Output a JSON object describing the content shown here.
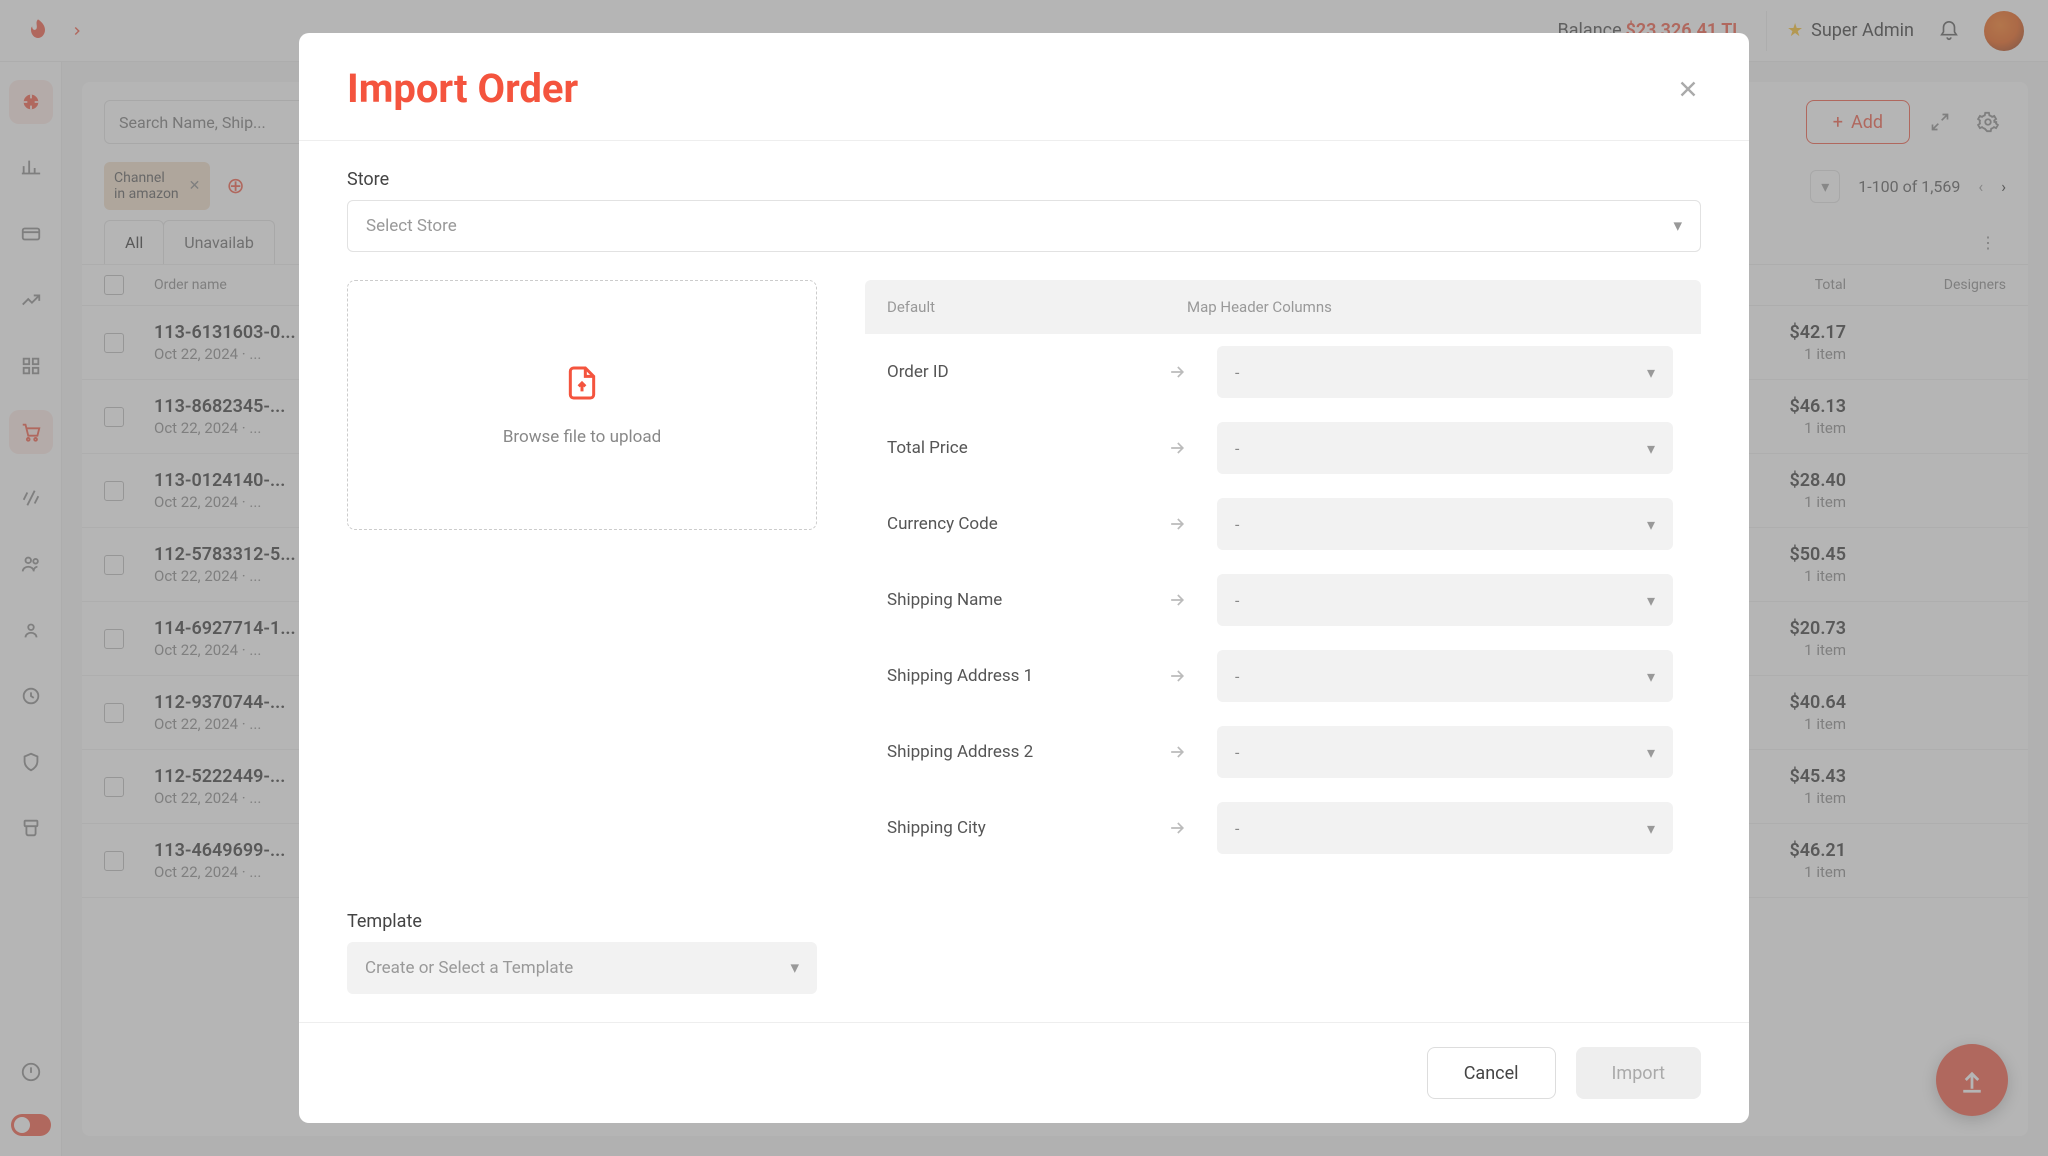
{
  "topbar": {
    "balance_label": "Balance",
    "balance_amount": "$23,326.41 TL",
    "role": "Super Admin"
  },
  "search": {
    "placeholder": "Search Name, Ship..."
  },
  "toolbar": {
    "add_label": "Add"
  },
  "filter_chip": {
    "label_line1": "Channel",
    "label_line2": "in amazon"
  },
  "pager": {
    "range": "1-100 of 1,569"
  },
  "tabs": {
    "all": "All",
    "unavailable": "Unavailab"
  },
  "columns": {
    "order_name": "Order name",
    "total": "Total",
    "designers": "Designers"
  },
  "orders": [
    {
      "id": "113-6131603-0...",
      "date": "Oct 22, 2024 · ...",
      "total": "$42.17",
      "items": "1 item"
    },
    {
      "id": "113-8682345-...",
      "date": "Oct 22, 2024 · ...",
      "total": "$46.13",
      "items": "1 item"
    },
    {
      "id": "113-0124140-...",
      "date": "Oct 22, 2024 · ...",
      "total": "$28.40",
      "items": "1 item"
    },
    {
      "id": "112-5783312-5...",
      "date": "Oct 22, 2024 · ...",
      "total": "$50.45",
      "items": "1 item"
    },
    {
      "id": "114-6927714-1...",
      "date": "Oct 22, 2024 · ...",
      "total": "$20.73",
      "items": "1 item"
    },
    {
      "id": "112-9370744-...",
      "date": "Oct 22, 2024 · ...",
      "total": "$40.64",
      "items": "1 item"
    },
    {
      "id": "112-5222449-...",
      "date": "Oct 22, 2024 · ...",
      "total": "$45.43",
      "items": "1 item"
    },
    {
      "id": "113-4649699-...",
      "date": "Oct 22, 2024 · ...",
      "total": "$46.21",
      "items": "1 item"
    }
  ],
  "modal": {
    "title": "Import Order",
    "store_label": "Store",
    "store_placeholder": "Select Store",
    "dropzone_text": "Browse file to upload",
    "template_label": "Template",
    "template_placeholder": "Create or Select a Template",
    "head_default": "Default",
    "head_map": "Map Header Columns",
    "map_placeholder": "-",
    "fields": [
      "Order ID",
      "Total Price",
      "Currency Code",
      "Shipping Name",
      "Shipping Address 1",
      "Shipping Address 2",
      "Shipping City"
    ],
    "cancel": "Cancel",
    "import": "Import"
  }
}
